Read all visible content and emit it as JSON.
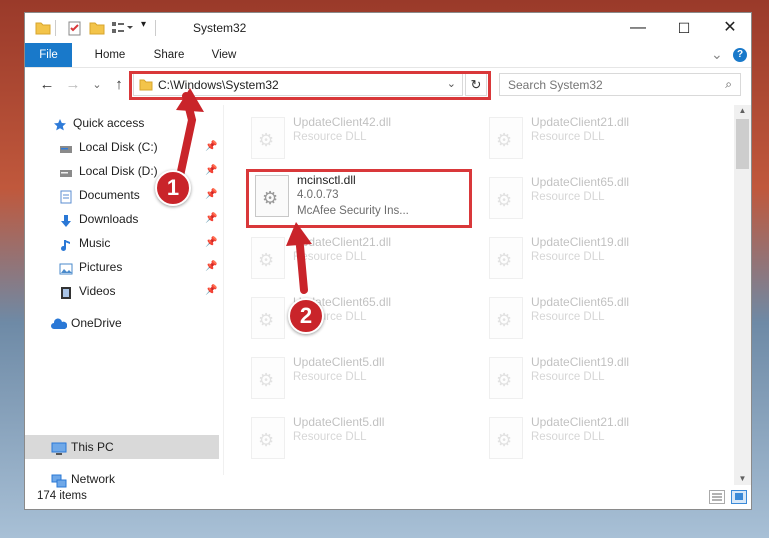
{
  "window": {
    "title": "System32",
    "controls": {
      "minimize": "—",
      "maximize": "☐",
      "close": "✕"
    }
  },
  "ribbon": {
    "tabs": [
      "File",
      "Home",
      "Share",
      "View"
    ],
    "collapse_glyph": "⌄",
    "help_glyph": "?"
  },
  "nav": {
    "back": "←",
    "forward": "→",
    "recent": "⌄",
    "up": "↑",
    "address": "C:\\Windows\\System32",
    "search_placeholder": "Search System32"
  },
  "sidebar": {
    "items": [
      {
        "label": "Quick access",
        "icon": "star-icon",
        "color": "#2f7bd8"
      },
      {
        "label": "Local Disk (C:)",
        "icon": "drive-icon",
        "color": "#6c6c6c",
        "pinned": true
      },
      {
        "label": "Local Disk (D:)",
        "icon": "drive-icon",
        "color": "#6c6c6c",
        "pinned": true
      },
      {
        "label": "Documents",
        "icon": "documents-icon",
        "color": "#5b8dd0",
        "pinned": true
      },
      {
        "label": "Downloads",
        "icon": "downloads-icon",
        "color": "#2a78d6",
        "pinned": true
      },
      {
        "label": "Music",
        "icon": "music-icon",
        "color": "#2a78d6",
        "pinned": true
      },
      {
        "label": "Pictures",
        "icon": "pictures-icon",
        "color": "#4a8acb",
        "pinned": true
      },
      {
        "label": "Videos",
        "icon": "videos-icon",
        "color": "#333333",
        "pinned": true
      },
      {
        "label": "OneDrive",
        "icon": "onedrive-icon",
        "color": "#2a78d6"
      },
      {
        "label": "This PC",
        "icon": "this-pc-icon",
        "color": "#2a78d6",
        "selected": true
      },
      {
        "label": "Network",
        "icon": "network-icon",
        "color": "#2a78d6"
      }
    ]
  },
  "files": {
    "highlighted": {
      "name": "mcinsctl.dll",
      "version": "4.0.0.73",
      "description": "McAfee Security Ins..."
    },
    "left_column": [
      {
        "name": "UpdateClient42.dll",
        "type": "Resource DLL"
      },
      {
        "name": "UpdateClient21.dll",
        "type": "Resource DLL"
      },
      {
        "name": "UpdateClient65.dll",
        "type": "Resource DLL"
      },
      {
        "name": "UpdateClient5.dll",
        "type": "Resource DLL"
      },
      {
        "name": "UpdateClient5.dll",
        "type": "Resource DLL"
      }
    ],
    "right_column": [
      {
        "name": "UpdateClient21.dll",
        "type": "Resource DLL"
      },
      {
        "name": "UpdateClient65.dll",
        "type": "Resource DLL"
      },
      {
        "name": "UpdateClient19.dll",
        "type": "Resource DLL"
      },
      {
        "name": "UpdateClient65.dll",
        "type": "Resource DLL"
      },
      {
        "name": "UpdateClient19.dll",
        "type": "Resource DLL"
      },
      {
        "name": "UpdateClient21.dll",
        "type": "Resource DLL"
      }
    ]
  },
  "status": {
    "item_count": "174 items"
  },
  "callouts": {
    "step1": "1",
    "step2": "2",
    "color": "#c9242a"
  },
  "colors": {
    "accent": "#1979ca",
    "highlight_box": "#d9383a"
  }
}
